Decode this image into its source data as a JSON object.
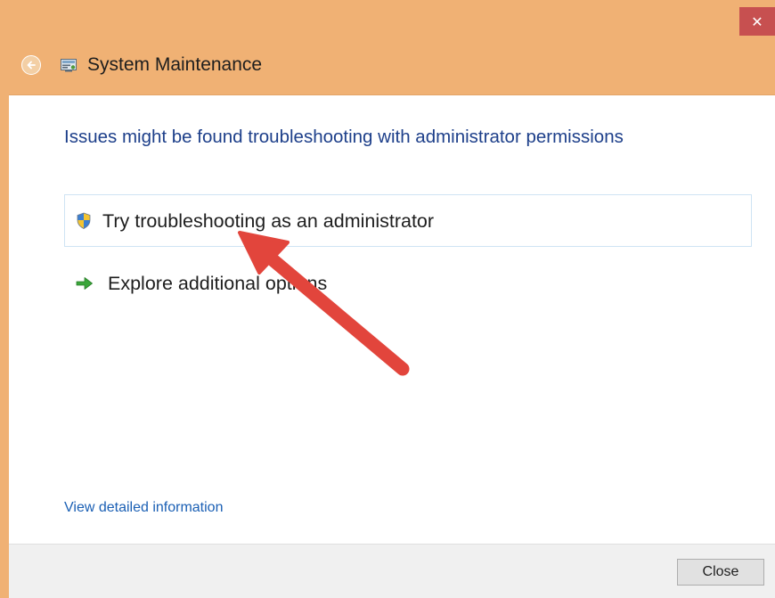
{
  "window": {
    "title": "System Maintenance",
    "close_glyph": "✕",
    "title_icon": "system-maintenance-icon",
    "back_icon": "back-arrow-icon"
  },
  "main": {
    "heading": "Issues might be found troubleshooting with administrator permissions",
    "options": [
      {
        "label": "Try troubleshooting as an administrator",
        "icon": "uac-shield-icon"
      },
      {
        "label": "Explore additional options",
        "icon": "green-arrow-icon"
      }
    ],
    "detail_link": "View detailed information"
  },
  "footer": {
    "close_label": "Close"
  },
  "colors": {
    "titlebar": "#f0b174",
    "heading": "#1d3f8a",
    "link": "#1a5fb4",
    "close_x_bg": "#c75050",
    "annotation_arrow": "#e2453c"
  }
}
